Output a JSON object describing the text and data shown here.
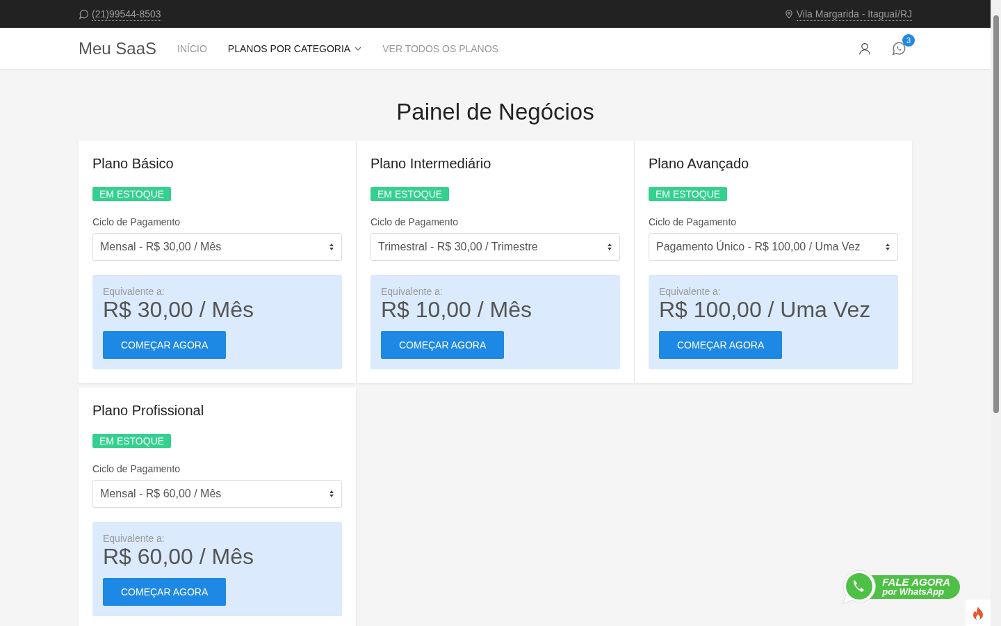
{
  "topbar": {
    "phone": "(21)99544-8503",
    "location": "Vila Margarida - Itaguaí/RJ"
  },
  "navbar": {
    "brand": "Meu SaaS",
    "items": [
      {
        "label": "INÍCIO",
        "selected": false,
        "kind": "link"
      },
      {
        "label": "PLANOS POR CATEGORIA",
        "selected": true,
        "kind": "dropdown"
      },
      {
        "label": "VER TODOS OS PLANOS",
        "selected": false,
        "kind": "link"
      }
    ],
    "messages_badge": "3"
  },
  "page_title": "Painel de Negócios",
  "plans": [
    {
      "name": "Plano Básico",
      "stock_badge": "EM ESTOQUE",
      "cycle_label": "Ciclo de Pagamento",
      "cycle_value": "Mensal - R$ 30,00 / Mês",
      "equivalent_label": "Equivalente a:",
      "equivalent_price": "R$ 30,00 / Mês",
      "button": "COMEÇAR AGORA"
    },
    {
      "name": "Plano Intermediário",
      "stock_badge": "EM ESTOQUE",
      "cycle_label": "Ciclo de Pagamento",
      "cycle_value": "Trimestral - R$ 30,00 / Trimestre",
      "equivalent_label": "Equivalente a:",
      "equivalent_price": "R$ 10,00 / Mês",
      "button": "COMEÇAR AGORA"
    },
    {
      "name": "Plano Avançado",
      "stock_badge": "EM ESTOQUE",
      "cycle_label": "Ciclo de Pagamento",
      "cycle_value": "Pagamento Único - R$ 100,00 / Uma Vez",
      "equivalent_label": "Equivalente a:",
      "equivalent_price": "R$ 100,00 / Uma Vez",
      "button": "COMEÇAR AGORA"
    },
    {
      "name": "Plano Profissional",
      "stock_badge": "EM ESTOQUE",
      "cycle_label": "Ciclo de Pagamento",
      "cycle_value": "Mensal - R$ 60,00 / Mês",
      "equivalent_label": "Equivalente a:",
      "equivalent_price": "R$ 60,00 / Mês",
      "button": "COMEÇAR AGORA"
    }
  ],
  "whatsapp_button": {
    "line_1": "FALE AGORA",
    "line_2": "por WhatsApp"
  }
}
